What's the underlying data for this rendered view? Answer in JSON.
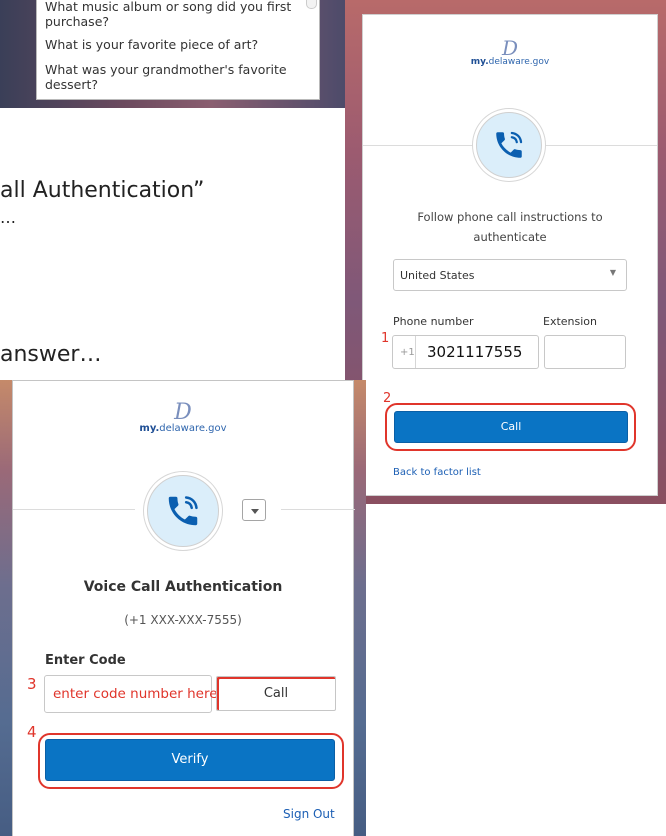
{
  "security_questions": {
    "options": [
      "What music album or song did you first purchase?",
      "What is your favorite piece of art?",
      "What was your grandmother's favorite dessert?"
    ]
  },
  "document": {
    "line1": "all Authentication”",
    "line2": "…",
    "line3": "answer…"
  },
  "phone_call_card": {
    "logo_mark": "D",
    "logo_prefix": "my.",
    "logo_domain": "delaware.gov",
    "heading_line1": "Follow phone call instructions to",
    "heading_line2": "authenticate",
    "country_select": "United States",
    "phone_label": "Phone number",
    "extension_label": "Extension",
    "country_code": "+1",
    "phone_value": "3021117555",
    "extension_value": "",
    "call_button": "Call",
    "back_link": "Back to factor list",
    "step1": "1",
    "step2": "2"
  },
  "voice_call_card": {
    "logo_mark": "D",
    "logo_prefix": "my.",
    "logo_domain": "delaware.gov",
    "title": "Voice Call Authentication",
    "phone_masked": "(+1 XXX-XXX-7555)",
    "code_label": "Enter Code",
    "code_placeholder": "enter code number here",
    "call_button": "Call",
    "verify_button": "Verify",
    "sign_out": "Sign Out",
    "step3": "3",
    "step4": "4"
  },
  "colors": {
    "accent_blue": "#0a74c4",
    "annotation_red": "#e0352b",
    "icon_bg": "#dbeefa"
  }
}
